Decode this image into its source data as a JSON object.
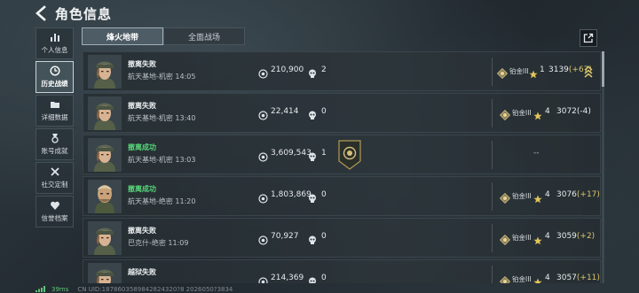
{
  "header": {
    "title": "角色信息"
  },
  "sidebar": {
    "items": [
      {
        "label": "个人信息",
        "icon": "bar-chart-icon",
        "active": false
      },
      {
        "label": "历史战绩",
        "icon": "history-clock-icon",
        "active": true
      },
      {
        "label": "详细数据",
        "icon": "folder-icon",
        "active": false
      },
      {
        "label": "账号成就",
        "icon": "medal-icon",
        "active": false
      },
      {
        "label": "社交定制",
        "icon": "crossed-tools-icon",
        "active": false
      },
      {
        "label": "信誉档案",
        "icon": "heart-shield-icon",
        "active": false
      }
    ]
  },
  "tabs": [
    {
      "label": "烽火地带",
      "active": true
    },
    {
      "label": "全面战场",
      "active": false
    }
  ],
  "matches": [
    {
      "status": "撤离失败",
      "result": "fail",
      "map": "航天基地-机密 14:05",
      "money": "210,900",
      "kills": "2",
      "rank": "铂金III",
      "level": "1",
      "score": "3139",
      "delta": "(+67)",
      "has_badge": false,
      "has_chevron": true
    },
    {
      "status": "撤离失败",
      "result": "fail",
      "map": "航天基地-机密 13:40",
      "money": "22,414",
      "kills": "0",
      "rank": "铂金III",
      "level": "4",
      "score": "3072",
      "delta": "(-4)",
      "has_badge": false,
      "has_chevron": false
    },
    {
      "status": "撤离成功",
      "result": "ok",
      "map": "航天基地-机密 13:03",
      "money": "3,609,543",
      "kills": "1",
      "rank": "",
      "level": "",
      "score": "",
      "delta": "",
      "dash": "--",
      "has_badge": true,
      "has_chevron": false
    },
    {
      "status": "撤离成功",
      "result": "ok",
      "map": "航天基地-绝密 11:20",
      "money": "1,803,869",
      "kills": "0",
      "rank": "铂金III",
      "level": "4",
      "score": "3076",
      "delta": "(+17)",
      "has_badge": false,
      "has_chevron": false
    },
    {
      "status": "撤离失败",
      "result": "fail",
      "map": "巴克什-绝密 11:09",
      "money": "70,927",
      "kills": "0",
      "rank": "铂金III",
      "level": "4",
      "score": "3059",
      "delta": "(+2)",
      "has_badge": false,
      "has_chevron": false
    },
    {
      "status": "越狱失败",
      "result": "fail",
      "map": "",
      "money": "214,369",
      "kills": "0",
      "rank": "铂金III",
      "level": "4",
      "score": "3057",
      "delta": "(+11)",
      "has_badge": false,
      "has_chevron": false
    }
  ],
  "footer": {
    "ping": "39ms",
    "uid": "CN UID:1878603589842824320?8 2026050?3834"
  },
  "colors": {
    "success": "#57d67a",
    "gold": "#d8c46a",
    "accent": "#c9d3d8"
  }
}
